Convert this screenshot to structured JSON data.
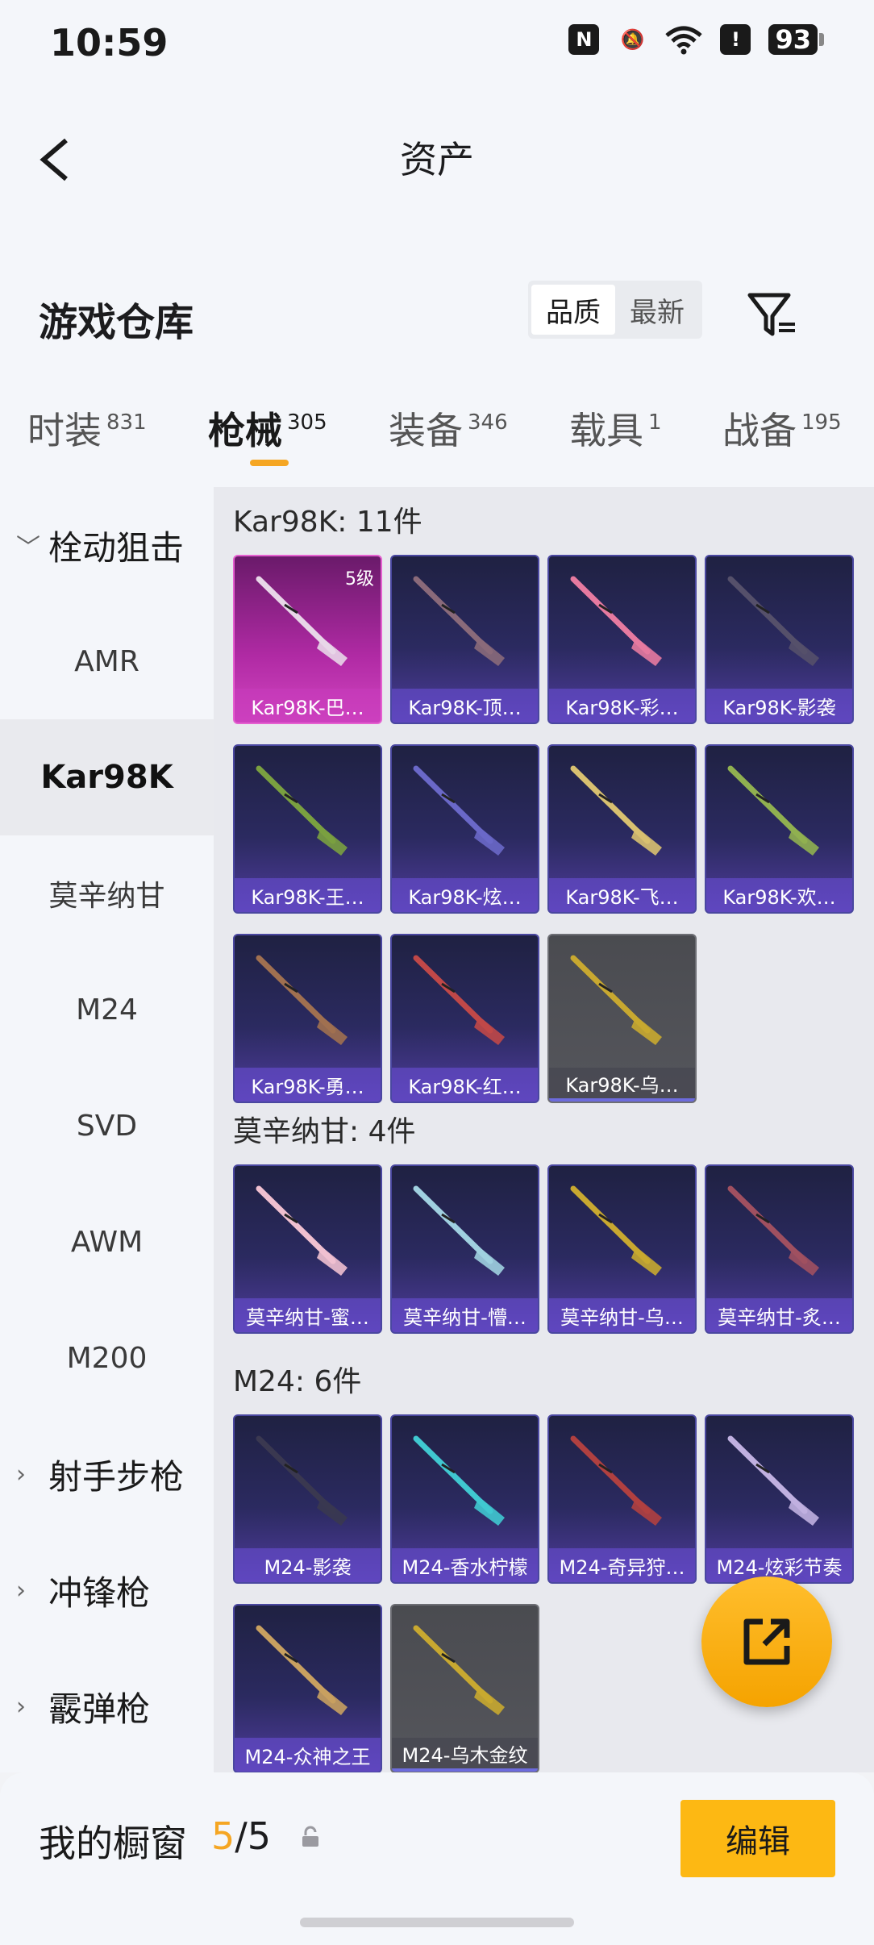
{
  "status": {
    "time": "10:59",
    "battery": "93"
  },
  "nav": {
    "title": "资产"
  },
  "warehouse": {
    "title": "游戏仓库",
    "sort_quality": "品质",
    "sort_newest": "最新"
  },
  "tabs": [
    {
      "label": "时装",
      "count": "831"
    },
    {
      "label": "枪械",
      "count": "305"
    },
    {
      "label": "装备",
      "count": "346"
    },
    {
      "label": "载具",
      "count": "1"
    },
    {
      "label": "战备",
      "count": "195"
    }
  ],
  "sidebar": {
    "group_bolt": "栓动狙击",
    "items": [
      "AMR",
      "Kar98K",
      "莫辛纳甘",
      "M24",
      "SVD",
      "AWM",
      "M200"
    ],
    "group_dmr": "射手步枪",
    "group_smg": "冲锋枪",
    "group_shotgun": "霰弹枪"
  },
  "sections": [
    {
      "title": "Kar98K: 11件",
      "items": [
        {
          "label": "Kar98K-巴…",
          "level": "5级",
          "style": "pink",
          "color": "#e8d6e8"
        },
        {
          "label": "Kar98K-顶…",
          "style": "purple",
          "color": "#8a6a7a"
        },
        {
          "label": "Kar98K-彩…",
          "style": "purple",
          "color": "#e67aa0"
        },
        {
          "label": "Kar98K-影袭",
          "style": "purple",
          "color": "#55506a"
        },
        {
          "label": "Kar98K-王…",
          "style": "purple",
          "color": "#7aa040"
        },
        {
          "label": "Kar98K-炫…",
          "style": "purple",
          "color": "#6a68c8"
        },
        {
          "label": "Kar98K-飞…",
          "style": "purple",
          "color": "#d8c070"
        },
        {
          "label": "Kar98K-欢…",
          "style": "purple",
          "color": "#90b050"
        },
        {
          "label": "Kar98K-勇…",
          "style": "purple",
          "color": "#a07050"
        },
        {
          "label": "Kar98K-红…",
          "style": "purple",
          "color": "#c04848"
        },
        {
          "label": "Kar98K-乌…",
          "style": "gray",
          "color": "#c8a830"
        }
      ]
    },
    {
      "title": "莫辛纳甘: 4件",
      "items": [
        {
          "label": "莫辛纳甘-蜜…",
          "style": "purple",
          "color": "#f0c0d0"
        },
        {
          "label": "莫辛纳甘-懵…",
          "style": "purple",
          "color": "#a0d0e0"
        },
        {
          "label": "莫辛纳甘-乌…",
          "style": "purple",
          "color": "#c8a830"
        },
        {
          "label": "莫辛纳甘-炙…",
          "style": "purple",
          "color": "#a05060"
        }
      ]
    },
    {
      "title": "M24: 6件",
      "items": [
        {
          "label": "M24-影袭",
          "style": "purple",
          "color": "#3a3850"
        },
        {
          "label": "M24-香水柠檬",
          "style": "purple",
          "color": "#40c8d0"
        },
        {
          "label": "M24-奇异狩…",
          "style": "purple",
          "color": "#b04040"
        },
        {
          "label": "M24-炫彩节奏",
          "style": "purple",
          "color": "#c0b0e0"
        },
        {
          "label": "M24-众神之王",
          "style": "purple",
          "color": "#c8a060"
        },
        {
          "label": "M24-乌木金纹",
          "style": "gray",
          "color": "#c8a830"
        }
      ]
    }
  ],
  "showcase": {
    "title": "我的橱窗",
    "current": "5",
    "total": "/5",
    "edit_label": "编辑"
  },
  "colors": {
    "accent": "#f5a623",
    "edit_button": "#fdb813"
  }
}
